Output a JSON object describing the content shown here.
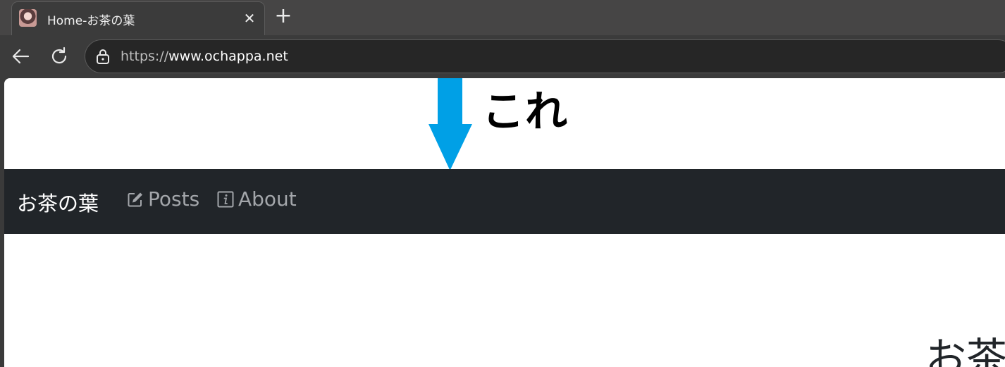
{
  "tab": {
    "title": "Home-お茶の葉"
  },
  "address_bar": {
    "url_scheme": "https://",
    "url_host": "www.ochappa.net"
  },
  "annotation": {
    "label": "これ",
    "arrow_color": "#00a0e6"
  },
  "navbar": {
    "brand": "お茶の葉",
    "links": [
      {
        "label": "Posts",
        "icon": "pencil-square-icon"
      },
      {
        "label": "About",
        "icon": "info-square-icon"
      }
    ],
    "background": "#212529"
  },
  "main": {
    "heading": "お茶の葉"
  }
}
